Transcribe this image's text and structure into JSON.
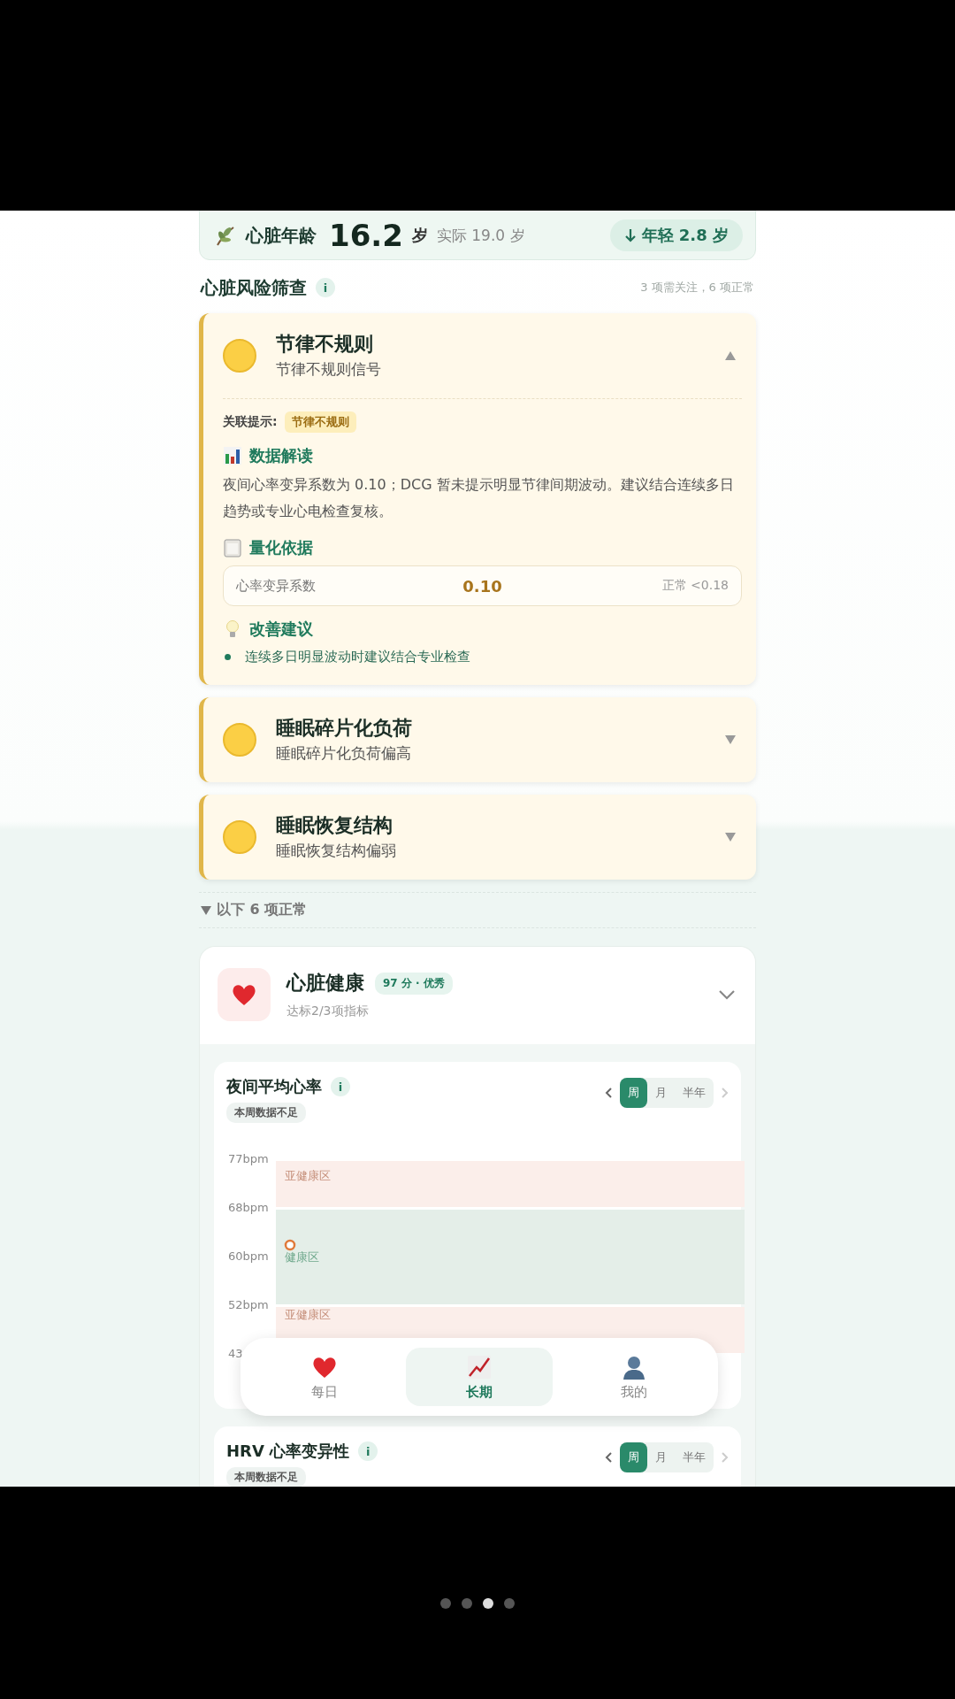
{
  "heart_age": {
    "label": "心脏年龄",
    "value": "16.2",
    "unit": "岁",
    "actual": "实际 19.0 岁",
    "badge": "年轻 2.8 岁"
  },
  "screening": {
    "title": "心脏风险筛查",
    "info": "i",
    "summary": "3 项需关注，6 项正常"
  },
  "risks": [
    {
      "title": "节律不规则",
      "subtitle": "节律不规则信号",
      "expanded": true,
      "detail": {
        "related_label": "关联提示:",
        "related_tag": "节律不规则",
        "sections": [
          {
            "kind": "text",
            "title": "数据解读",
            "text": "夜间心率变异系数为 0.10；DCG 暂未提示明显节律间期波动。建议结合连续多日趋势或专业心电检查复核。"
          },
          {
            "kind": "metric",
            "title": "量化依据",
            "metric": {
              "name": "心率变异系数",
              "value": "0.10",
              "range": "正常 <0.18"
            }
          },
          {
            "kind": "list",
            "title": "改善建议",
            "items": [
              "连续多日明显波动时建议结合专业检查"
            ]
          }
        ]
      }
    },
    {
      "title": "睡眠碎片化负荷",
      "subtitle": "睡眠碎片化负荷偏高",
      "expanded": false
    },
    {
      "title": "睡眠恢复结构",
      "subtitle": "睡眠恢复结构偏弱",
      "expanded": false
    }
  ],
  "normal_toggle": {
    "text": "以下 6 项正常",
    "expanded": true
  },
  "category": {
    "title": "心脏健康",
    "score": "97 分 · 优秀",
    "subtitle": "达标2/3项指标"
  },
  "metrics": [
    {
      "title": "夜间平均心率",
      "info": "i",
      "note": "本周数据不足",
      "periods": [
        {
          "label": "周",
          "selected": true
        },
        {
          "label": "月",
          "selected": false
        },
        {
          "label": "半年",
          "selected": false
        }
      ],
      "chart": {
        "y_labels": [
          "77bpm",
          "68bpm",
          "60bpm",
          "52bpm",
          "43"
        ],
        "zones": [
          {
            "kind": "warn",
            "label": "亚健康区"
          },
          {
            "kind": "ok",
            "label": "健康区"
          },
          {
            "kind": "warn",
            "label": "亚健康区"
          }
        ]
      }
    },
    {
      "title": "HRV 心率变异性",
      "info": "i",
      "note": "本周数据不足",
      "periods": [
        {
          "label": "周",
          "selected": true
        },
        {
          "label": "月",
          "selected": false
        },
        {
          "label": "半年",
          "selected": false
        }
      ]
    }
  ],
  "nav": [
    {
      "label": "每日",
      "selected": false
    },
    {
      "label": "长期",
      "selected": true
    },
    {
      "label": "我的",
      "selected": false
    }
  ],
  "pages": [
    {
      "selected": false
    },
    {
      "selected": false
    },
    {
      "selected": true
    },
    {
      "selected": false
    }
  ]
}
